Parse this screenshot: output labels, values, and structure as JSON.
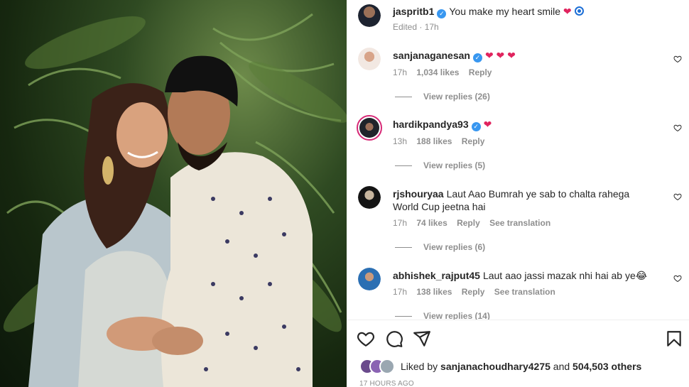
{
  "post": {
    "author": "jaspritb1",
    "caption": "You make my heart smile",
    "caption_emoji": "❤",
    "edited": "Edited · 17h"
  },
  "comments": [
    {
      "username": "sanjanaganesan",
      "verified": true,
      "text": "❤ ❤ ❤",
      "time": "17h",
      "likes": "1,034 likes",
      "reply": "Reply",
      "translation": "",
      "view_replies": "View replies (26)"
    },
    {
      "username": "hardikpandya93",
      "verified": true,
      "text": "❤",
      "time": "13h",
      "likes": "188 likes",
      "reply": "Reply",
      "translation": "",
      "view_replies": "View replies (5)"
    },
    {
      "username": "rjshouryaa",
      "verified": false,
      "text": "Laut Aao Bumrah ye sab to chalta rahega World Cup jeetna hai",
      "time": "17h",
      "likes": "74 likes",
      "reply": "Reply",
      "translation": "See translation",
      "view_replies": "View replies (6)"
    },
    {
      "username": "abhishek_rajput45",
      "verified": false,
      "text": "Laut aao jassi mazak nhi hai ab ye😂",
      "time": "17h",
      "likes": "138 likes",
      "reply": "Reply",
      "translation": "See translation",
      "view_replies": "View replies (14)"
    }
  ],
  "likes": {
    "prefix": "Liked by",
    "user": "sanjanachoudhary4275",
    "and": "and",
    "count": "504,503 others"
  },
  "timestamp": "17 HOURS AGO",
  "icons": [
    "heart-icon",
    "comment-icon",
    "share-icon",
    "bookmark-icon",
    "verified-badge-icon"
  ],
  "colors": {
    "verified": "#3897f0",
    "heart": "#e0245e",
    "muted": "#8e8e8e",
    "story_ring": "#d62976"
  }
}
